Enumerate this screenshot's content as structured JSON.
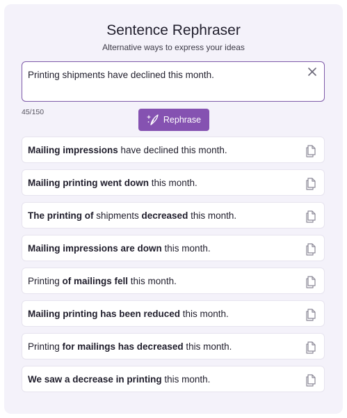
{
  "header": {
    "title": "Sentence Rephraser",
    "subtitle": "Alternative ways to express your ideas"
  },
  "input": {
    "value": "Printing shipments have declined this month.",
    "char_count": "45/150",
    "clear_icon": "close-icon"
  },
  "rephrase_button": {
    "label": "Rephrase",
    "icon": "sparkle-feather-icon",
    "color": "#8552b1"
  },
  "results": [
    {
      "segments": [
        {
          "text": "Mailing impressions",
          "bold": true
        },
        {
          "text": " have declined this month.",
          "bold": false
        }
      ]
    },
    {
      "segments": [
        {
          "text": "Mailing printing went down",
          "bold": true
        },
        {
          "text": " this month.",
          "bold": false
        }
      ]
    },
    {
      "segments": [
        {
          "text": "The printing of",
          "bold": true
        },
        {
          "text": " shipments ",
          "bold": false
        },
        {
          "text": "decreased",
          "bold": true
        },
        {
          "text": " this month.",
          "bold": false
        }
      ]
    },
    {
      "segments": [
        {
          "text": "Mailing impressions are down",
          "bold": true
        },
        {
          "text": " this month.",
          "bold": false
        }
      ]
    },
    {
      "segments": [
        {
          "text": "Printing ",
          "bold": false
        },
        {
          "text": "of mailings fell",
          "bold": true
        },
        {
          "text": " this month.",
          "bold": false
        }
      ]
    },
    {
      "segments": [
        {
          "text": "Mailing printing has been reduced",
          "bold": true
        },
        {
          "text": " this month.",
          "bold": false
        }
      ]
    },
    {
      "segments": [
        {
          "text": "Printing ",
          "bold": false
        },
        {
          "text": "for mailings has decreased",
          "bold": true
        },
        {
          "text": " this month.",
          "bold": false
        }
      ]
    },
    {
      "segments": [
        {
          "text": "We saw a decrease in printing",
          "bold": true
        },
        {
          "text": " this month.",
          "bold": false
        }
      ]
    }
  ],
  "copy_icon": "copy-icon",
  "colors": {
    "accent": "#8552b1",
    "input_border": "#7d59a8",
    "panel_bg": "#f4f2fa"
  }
}
